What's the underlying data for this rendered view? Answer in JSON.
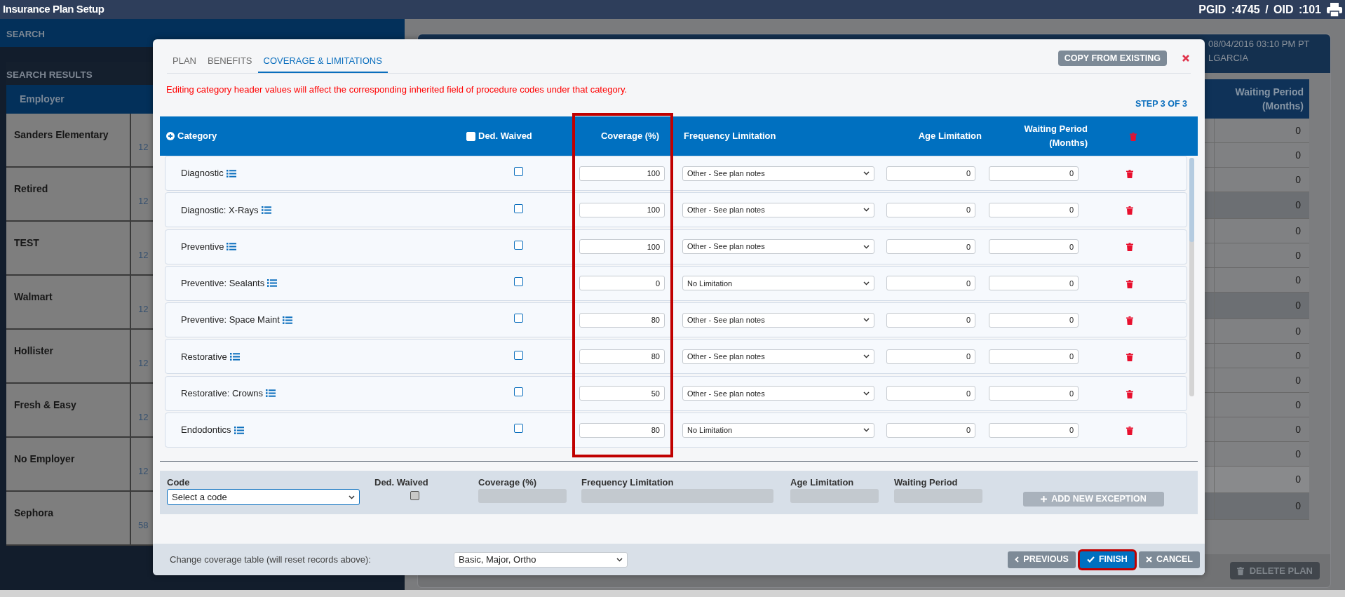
{
  "app_bar": {
    "title": "Insurance Plan Setup",
    "ids": "PGID :4745 / OID :101"
  },
  "search_panel": {
    "title": "SEARCH",
    "results_title": "SEARCH RESULTS",
    "columns": [
      "Employer"
    ],
    "rows": [
      {
        "employer": "Sanders Elementary",
        "column_2": "12"
      },
      {
        "employer": "Retired",
        "column_2": "12"
      },
      {
        "employer": "TEST",
        "column_2": "12"
      },
      {
        "employer": "Walmart",
        "column_2": "12"
      },
      {
        "employer": "Hollister",
        "column_2": "12"
      },
      {
        "employer": "Fresh & Easy",
        "column_2": "12"
      },
      {
        "employer": "No Employer",
        "column_2": "12"
      },
      {
        "employer": "Sephora",
        "column_2": "58"
      }
    ]
  },
  "plan_panel": {
    "header_lines": [
      "08/04/2016 03:10 PM PT",
      "LGARCIA"
    ],
    "table": {
      "columns": [
        "Waiting Period (Months)"
      ],
      "rows": [
        {
          "kind": "item",
          "value": "0"
        },
        {
          "kind": "item",
          "value": "0"
        },
        {
          "kind": "item",
          "value": "0"
        },
        {
          "kind": "group",
          "value": "0"
        },
        {
          "kind": "item",
          "value": "0"
        },
        {
          "kind": "item",
          "value": "0"
        },
        {
          "kind": "item",
          "value": "0"
        },
        {
          "kind": "group",
          "value": "0"
        },
        {
          "kind": "item",
          "value": "0"
        },
        {
          "kind": "item",
          "value": "0"
        },
        {
          "kind": "item",
          "value": "0"
        },
        {
          "kind": "item",
          "value": "0"
        },
        {
          "kind": "item",
          "value": "0"
        },
        {
          "kind": "item",
          "value": "0"
        },
        {
          "kind": "summary",
          "value": "0"
        },
        {
          "kind": "group",
          "value": "0"
        }
      ]
    },
    "buttons": [
      "DELETE PLAN"
    ]
  },
  "dialog": {
    "tabs": [
      {
        "label": "PLAN",
        "selected": false
      },
      {
        "label": "BENEFITS",
        "selected": false
      },
      {
        "label": "COVERAGE & LIMITATIONS",
        "selected": true
      }
    ],
    "copy_button": "COPY FROM EXISTING",
    "warning": "Editing category header values will affect the corresponding inherited field of procedure codes under that category.",
    "step": "STEP 3 OF 3",
    "table": {
      "columns": [
        {
          "kind": "category",
          "label": "Category"
        },
        {
          "kind": "checkbox",
          "label": "Ded. Waived",
          "checked": false
        },
        {
          "kind": "text",
          "label": "Coverage (%)",
          "highlighted": true
        },
        {
          "kind": "text",
          "label": "Frequency Limitation",
          "highlighted": false
        },
        {
          "kind": "text",
          "label": "Age Limitation",
          "highlighted": false
        },
        {
          "kind": "text",
          "label": "Waiting Period (Months)",
          "highlighted": false
        },
        {
          "kind": "delete"
        }
      ],
      "rows": [
        {
          "category": "Diagnostic",
          "ded_waived": false,
          "coverage": "100",
          "frequency": "Other - See plan notes",
          "age": "0",
          "waiting": "0"
        },
        {
          "category": "Diagnostic: X-Rays",
          "ded_waived": false,
          "coverage": "100",
          "frequency": "Other - See plan notes",
          "age": "0",
          "waiting": "0"
        },
        {
          "category": "Preventive",
          "ded_waived": false,
          "coverage": "100",
          "frequency": "Other - See plan notes",
          "age": "0",
          "waiting": "0"
        },
        {
          "category": "Preventive: Sealants",
          "ded_waived": false,
          "coverage": "0",
          "frequency": "No Limitation",
          "age": "0",
          "waiting": "0"
        },
        {
          "category": "Preventive: Space Maint",
          "ded_waived": false,
          "coverage": "80",
          "frequency": "Other - See plan notes",
          "age": "0",
          "waiting": "0"
        },
        {
          "category": "Restorative",
          "ded_waived": false,
          "coverage": "80",
          "frequency": "Other - See plan notes",
          "age": "0",
          "waiting": "0"
        },
        {
          "category": "Restorative: Crowns",
          "ded_waived": false,
          "coverage": "50",
          "frequency": "Other - See plan notes",
          "age": "0",
          "waiting": "0"
        },
        {
          "category": "Endodontics",
          "ded_waived": false,
          "coverage": "80",
          "frequency": "No Limitation",
          "age": "0",
          "waiting": "0"
        }
      ]
    },
    "exception": {
      "fields": [
        {
          "kind": "select",
          "label": "Code",
          "value": "Select a code",
          "disabled": false
        },
        {
          "kind": "checkbox",
          "label": "Ded. Waived",
          "checked": false,
          "disabled": true
        },
        {
          "kind": "input",
          "label": "Coverage (%)",
          "disabled": true
        },
        {
          "kind": "input",
          "label": "Frequency Limitation",
          "disabled": true
        },
        {
          "kind": "input",
          "label": "Age Limitation",
          "disabled": true
        },
        {
          "kind": "input",
          "label": "Waiting Period",
          "disabled": true
        }
      ],
      "add_button": {
        "label": "ADD NEW EXCEPTION",
        "disabled": true
      }
    },
    "footer": {
      "label": "Change coverage table (will reset records above):",
      "table_select": "Basic, Major, Ortho",
      "buttons": [
        {
          "kind": "previous",
          "label": "PREVIOUS",
          "highlighted": false
        },
        {
          "kind": "finish",
          "label": "FINISH",
          "highlighted": true
        },
        {
          "kind": "cancel",
          "label": "CANCEL",
          "highlighted": false
        }
      ]
    }
  }
}
